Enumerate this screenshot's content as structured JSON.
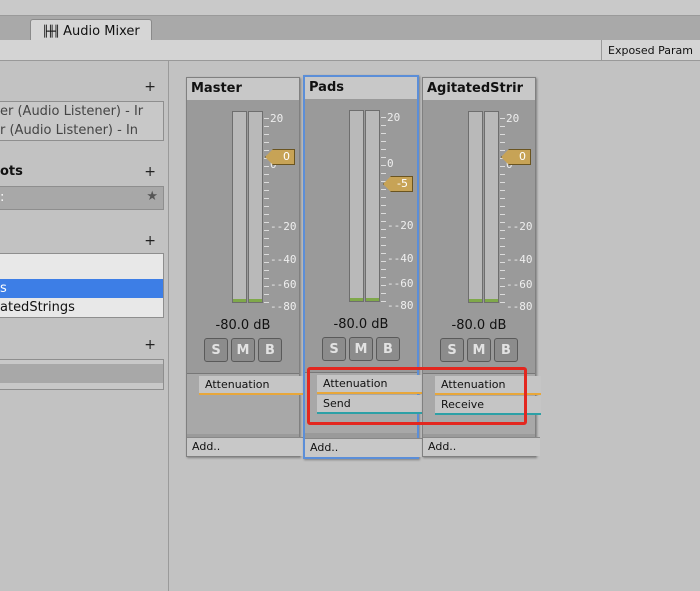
{
  "window": {
    "tab_title": "Audio Mixer",
    "tab_icon": "mixer-icon",
    "exposed_params_label": "Exposed Param"
  },
  "left_panel": {
    "mixers": {
      "add_label": "+",
      "rows": [
        "er  (Audio Listener) - Ir",
        "r  (Audio Listener) - In"
      ]
    },
    "snapshots": {
      "header": "ots",
      "add_label": "+",
      "rows": [
        ":"
      ],
      "star_icon": "star-icon"
    },
    "groups": {
      "add_label": "+",
      "rows": [
        "",
        "s",
        "atedStrings"
      ],
      "selected_index": 1
    },
    "views": {
      "add_label": "+",
      "rows": [
        ""
      ]
    }
  },
  "strips": [
    {
      "name": "Master",
      "fader_value": "0",
      "db_label": "-80.0 dB",
      "buttons": [
        "S",
        "M",
        "B"
      ],
      "effects": [
        {
          "label": "Attenuation",
          "color": "#e8a73a"
        }
      ],
      "add_label": "Add..",
      "selected": false
    },
    {
      "name": "Pads",
      "fader_value": "-5",
      "db_label": "-80.0 dB",
      "buttons": [
        "S",
        "M",
        "B"
      ],
      "effects": [
        {
          "label": "Attenuation",
          "color": "#e8a73a"
        },
        {
          "label": "Send",
          "color": "#2da0a6"
        }
      ],
      "add_label": "Add..",
      "selected": true
    },
    {
      "name": "AgitatedStrir",
      "fader_value": "0",
      "db_label": "-80.0 dB",
      "buttons": [
        "S",
        "M",
        "B"
      ],
      "effects": [
        {
          "label": "Attenuation",
          "color": "#e8a73a"
        },
        {
          "label": "Receive",
          "color": "#2da0a6"
        }
      ],
      "add_label": "Add..",
      "selected": false
    }
  ],
  "meter_scale": [
    "20",
    "0",
    "-20",
    "-40",
    "-60",
    "-80"
  ],
  "highlight_color": "#e3271f"
}
